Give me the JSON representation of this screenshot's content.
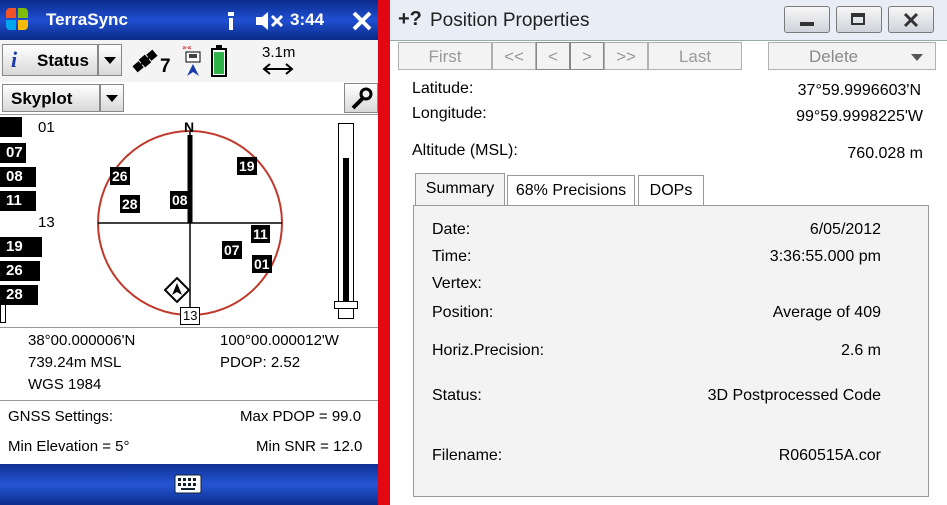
{
  "left": {
    "title": "TerraSync",
    "clock": "3:44",
    "status_btn": "Status",
    "sat_count": "7",
    "range": "3.1m",
    "skyplot_btn": "Skyplot",
    "north": "N",
    "sv_list": [
      {
        "id": "01",
        "filled": false
      },
      {
        "id": "07",
        "filled": true
      },
      {
        "id": "08",
        "filled": true
      },
      {
        "id": "11",
        "filled": true
      },
      {
        "id": "13",
        "filled": false
      },
      {
        "id": "19",
        "filled": true
      },
      {
        "id": "26",
        "filled": true
      },
      {
        "id": "28",
        "filled": true
      }
    ],
    "sky_sats": [
      "19",
      "26",
      "28",
      "08",
      "07",
      "11",
      "01",
      "13"
    ],
    "lat": "38°00.000006'N",
    "lon": "100°00.000012'W",
    "alt": "739.24m MSL",
    "pdop": "PDOP: 2.52",
    "datum": "WGS 1984",
    "gnss_settings": "GNSS Settings:",
    "max_pdop": "Max PDOP = 99.0",
    "min_elev": "Min Elevation = 5°",
    "min_snr": "Min SNR = 12.0"
  },
  "right": {
    "title": "Position Properties",
    "nav": {
      "first": "First",
      "prev2": "<<",
      "prev": "<",
      "next": ">",
      "next2": ">>",
      "last": "Last",
      "delete": "Delete"
    },
    "latitude_label": "Latitude:",
    "latitude_value": "37°59.9996603'N",
    "longitude_label": "Longitude:",
    "longitude_value": "99°59.9998225'W",
    "altitude_label": "Altitude (MSL):",
    "altitude_value": "760.028 m",
    "tabs": [
      "Summary",
      "68% Precisions",
      "DOPs"
    ],
    "summary": {
      "date_label": "Date:",
      "date_value": "6/05/2012",
      "time_label": "Time:",
      "time_value": "3:36:55.000 pm",
      "vertex_label": "Vertex:",
      "position_label": "Position:",
      "position_value": "Average of 409",
      "hp_label": "Horiz.Precision:",
      "hp_value": "2.6 m",
      "status_label": "Status:",
      "status_value": "3D Postprocessed Code",
      "filename_label": "Filename:",
      "filename_value": "R060515A.cor"
    }
  },
  "colors": {
    "divider": "#e30613",
    "title_blue": "#1f4fd1"
  }
}
